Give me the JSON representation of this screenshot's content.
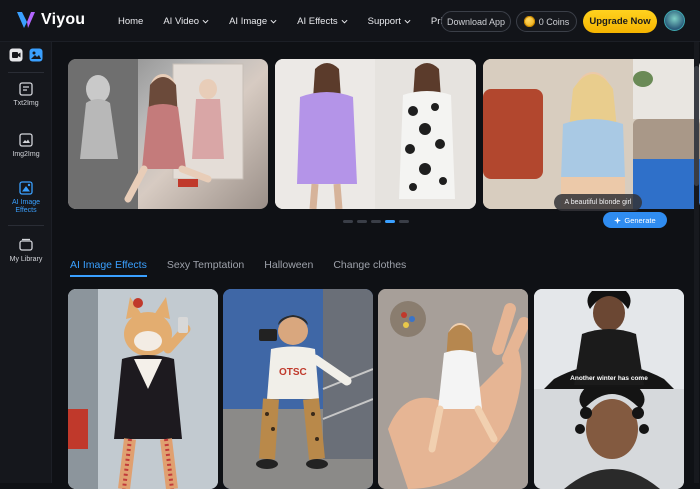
{
  "brand": {
    "name": "Viyou"
  },
  "nav": [
    {
      "label": "Home",
      "dropdown": false
    },
    {
      "label": "AI Video",
      "dropdown": true
    },
    {
      "label": "AI Image",
      "dropdown": true
    },
    {
      "label": "AI Effects",
      "dropdown": true
    },
    {
      "label": "Support",
      "dropdown": true
    },
    {
      "label": "Pricing",
      "dropdown": false
    }
  ],
  "header": {
    "download_label": "Download App",
    "coins_label": "0 Coins",
    "upgrade_label": "Upgrade Now"
  },
  "sidebar": {
    "items": [
      {
        "label": "Txt2Img",
        "icon": "text-image-icon"
      },
      {
        "label": "Img2Img",
        "icon": "image-image-icon"
      },
      {
        "label": "AI Image Effects",
        "icon": "image-effects-icon",
        "active": true
      },
      {
        "label": "My Library",
        "icon": "library-icon"
      }
    ]
  },
  "banner": {
    "prompt_text": "A beautiful blonde girl",
    "generate_label": "Generate",
    "active_dot": 3,
    "dot_count": 5
  },
  "tabs": [
    {
      "label": "AI Image Effects",
      "active": true
    },
    {
      "label": "Sexy Temptation",
      "active": false
    },
    {
      "label": "Halloween",
      "active": false
    },
    {
      "label": "Change clothes",
      "active": false
    }
  ],
  "grid": {
    "card4_caption": "Another winter has come"
  },
  "colors": {
    "accent": "#3aa0ff",
    "upgrade": "#f5b400",
    "background": "#0f1115"
  }
}
